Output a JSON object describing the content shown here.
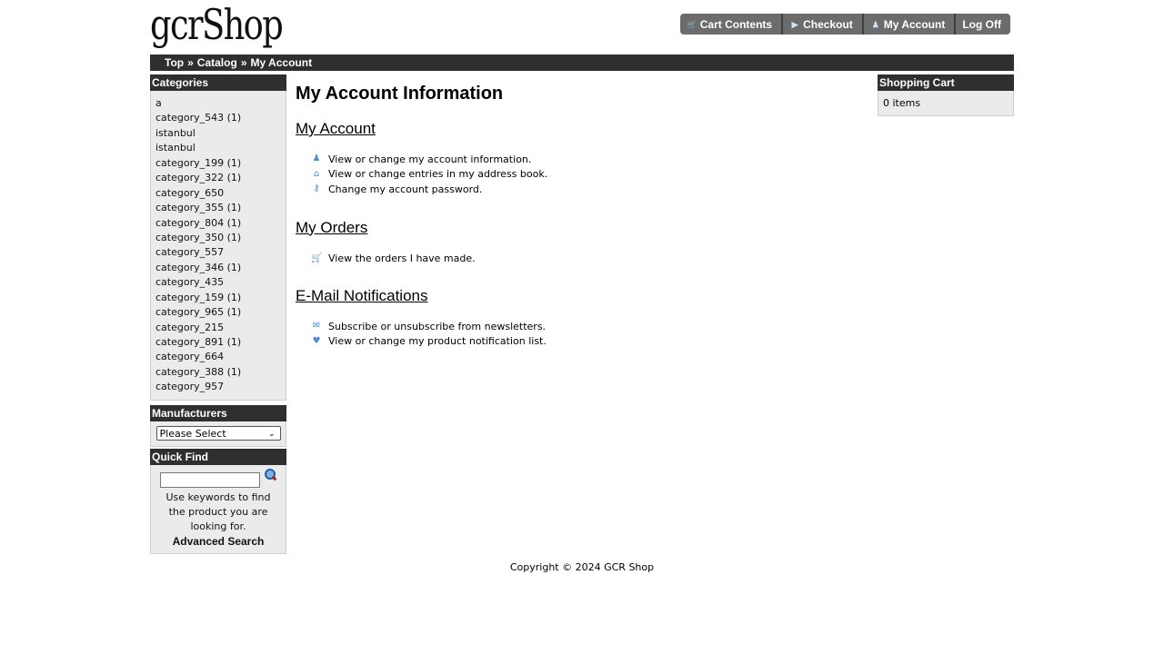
{
  "header": {
    "logo": "gcrShop",
    "nav": [
      {
        "label": "Cart Contents",
        "icon": "cart-icon"
      },
      {
        "label": "Checkout",
        "icon": "arrow-right-icon"
      },
      {
        "label": "My Account",
        "icon": "user-icon"
      },
      {
        "label": "Log Off",
        "icon": ""
      }
    ]
  },
  "breadcrumb": [
    "Top",
    "Catalog",
    "My Account"
  ],
  "breadcrumb_sep": "»",
  "categories": {
    "title": "Categories",
    "items": [
      "a",
      "category_543 (1)",
      "istanbul",
      "istanbul",
      "category_199 (1)",
      "category_322 (1)",
      "category_650",
      "category_355 (1)",
      "category_804 (1)",
      "category_350 (1)",
      "category_557",
      "category_346 (1)",
      "category_435",
      "category_159 (1)",
      "category_965 (1)",
      "category_215",
      "category_891 (1)",
      "category_664",
      "category_388 (1)",
      "category_957"
    ]
  },
  "manufacturers": {
    "title": "Manufacturers",
    "selected": "Please Select"
  },
  "quickfind": {
    "title": "Quick Find",
    "input_value": "",
    "help": "Use keywords to find the product you are looking for.",
    "advanced": "Advanced Search"
  },
  "main": {
    "title": "My Account Information",
    "sections": [
      {
        "heading": "My Account",
        "links": [
          {
            "icon": "user-icon",
            "text": "View or change my account information."
          },
          {
            "icon": "home-icon",
            "text": "View or change entries in my address book."
          },
          {
            "icon": "key-icon",
            "text": "Change my account password."
          }
        ]
      },
      {
        "heading": "My Orders",
        "links": [
          {
            "icon": "cart-icon",
            "text": "View the orders I have made."
          }
        ]
      },
      {
        "heading": "E-Mail Notifications",
        "links": [
          {
            "icon": "envelope-icon",
            "text": "Subscribe or unsubscribe from newsletters."
          },
          {
            "icon": "heart-icon",
            "text": "View or change my product notification list."
          }
        ]
      }
    ]
  },
  "cart": {
    "title": "Shopping Cart",
    "contents": "0 items"
  },
  "footer": {
    "copyright": "Copyright © 2024 GCR Shop"
  }
}
